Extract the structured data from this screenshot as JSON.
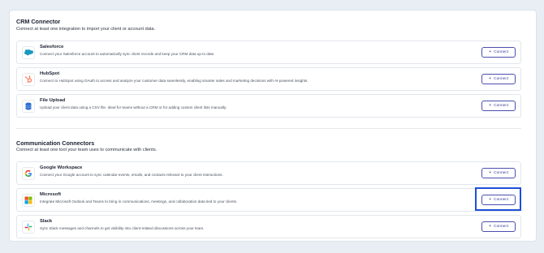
{
  "crm": {
    "title": "CRM Connector",
    "subtitle": "Connect at least one integration to import your client or account data.",
    "items": [
      {
        "name": "Salesforce",
        "description": "Connect your Salesforce account to automatically sync client records and keep your CRM data up to date.",
        "icon": "salesforce-icon",
        "button": "Connect"
      },
      {
        "name": "HubSpot",
        "description": "Connect to HubSpot using OAuth to access and analyze your customer data seamlessly, enabling smarter sales and marketing decisions with AI-powered insights.",
        "icon": "hubspot-icon",
        "button": "Connect"
      },
      {
        "name": "File Upload",
        "description": "Upload your client data using a CSV file. Ideal for teams without a CRM or for adding custom client lists manually.",
        "icon": "file-upload-icon",
        "button": "Connect"
      }
    ]
  },
  "communication": {
    "title": "Communication Connectors",
    "subtitle": "Connect at least one tool your team uses to communicate with clients.",
    "items": [
      {
        "name": "Google Workspace",
        "description": "Connect your Google account to sync calendar events, emails, and contacts relevant to your client interactions.",
        "icon": "google-icon",
        "button": "Connect"
      },
      {
        "name": "Microsoft",
        "description": "Integrate Microsoft Outlook and Teams to bring in communications, meetings, and collaboration data tied to your clients.",
        "icon": "microsoft-icon",
        "button": "Connect"
      },
      {
        "name": "Slack",
        "description": "Sync Slack messages and channels to get visibility into client-related discussions across your team.",
        "icon": "slack-icon",
        "button": "Connect"
      }
    ]
  },
  "colors": {
    "accent": "#3a3f9a",
    "highlight": "#1f4fd6",
    "background": "#e8eef3"
  }
}
